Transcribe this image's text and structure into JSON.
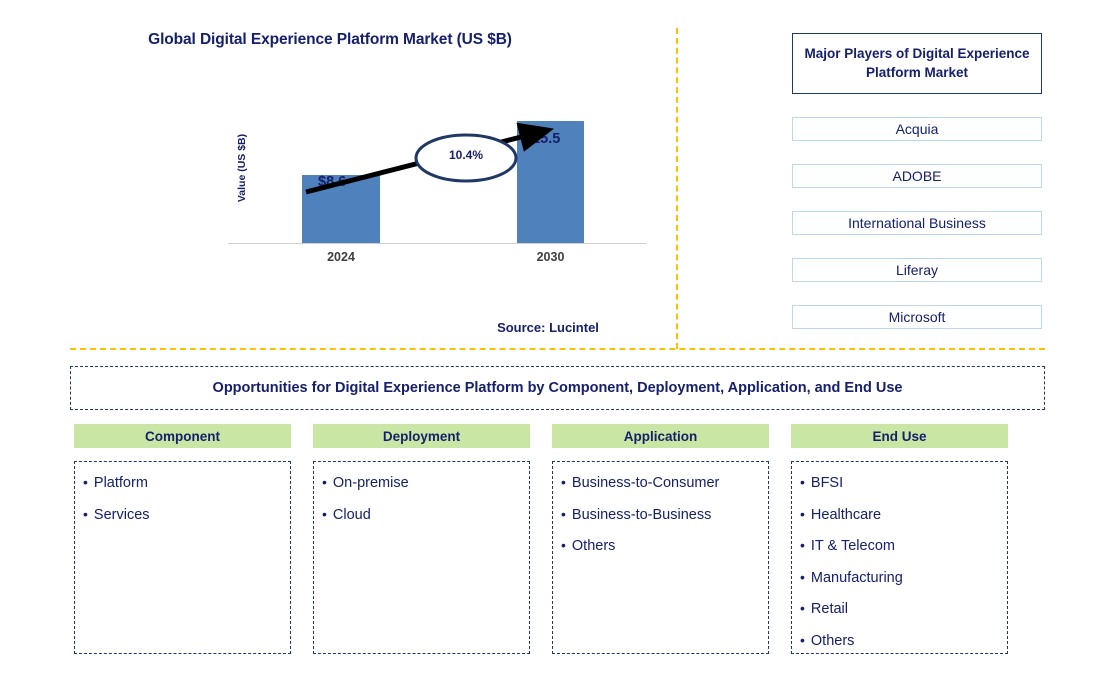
{
  "chart_panel": {
    "title": "Global Digital Experience Platform Market (US $B)",
    "source": "Source: Lucintel"
  },
  "chart_data": {
    "type": "bar",
    "title": "Global Digital Experience Platform Market (US $B)",
    "categories": [
      "2024",
      "2030"
    ],
    "values": [
      8.6,
      15.5
    ],
    "value_labels": [
      "$8.6",
      "$15.5"
    ],
    "xlabel": "",
    "ylabel": "Value (US $B)",
    "ylim": [
      0,
      16
    ],
    "grid": false,
    "legend": "none",
    "bar_color": "#4F81BD",
    "annotations": [
      {
        "name": "cagr",
        "text": "10.4%",
        "shape": "ellipse-on-arrow"
      }
    ]
  },
  "players": {
    "header": "Major Players of Digital Experience Platform Market",
    "items": [
      {
        "label": "Acquia"
      },
      {
        "label": "ADOBE"
      },
      {
        "label": "International Business"
      },
      {
        "label": "Liferay"
      },
      {
        "label": "Microsoft"
      }
    ]
  },
  "opportunities": {
    "banner": "Opportunities for Digital Experience Platform by Component, Deployment, Application, and End Use",
    "columns": [
      {
        "header": "Component",
        "items": [
          "Platform",
          "Services"
        ]
      },
      {
        "header": "Deployment",
        "items": [
          "On-premise",
          "Cloud"
        ]
      },
      {
        "header": "Application",
        "items": [
          "Business-to-Consumer",
          "Business-to-Business",
          "Others"
        ]
      },
      {
        "header": "End Use",
        "items": [
          "BFSI",
          "Healthcare",
          "IT & Telecom",
          "Manufacturing",
          "Retail",
          "Others"
        ]
      }
    ]
  },
  "colors": {
    "navy": "#16206B",
    "bar_blue": "#4F81BD",
    "divider_gold": "#FFC000",
    "header_green": "#CAE6A4",
    "player_border": "#BDD7EE"
  }
}
